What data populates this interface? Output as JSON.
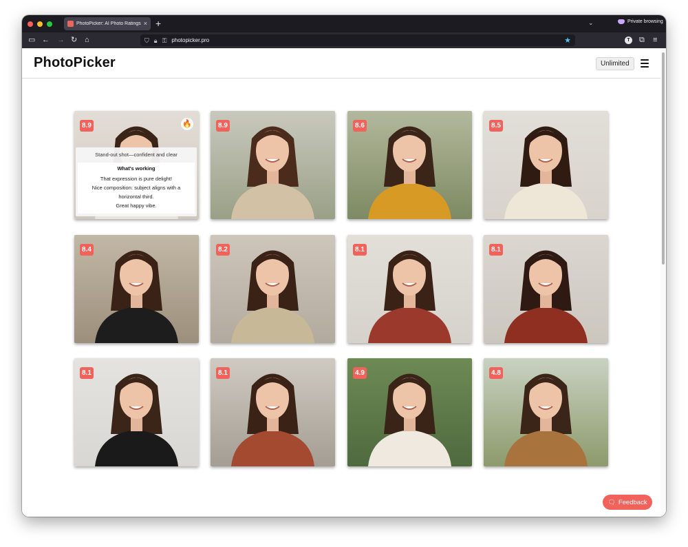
{
  "browser": {
    "tab_title": "PhotoPicker: AI Photo Ratings fo",
    "tab_close": "×",
    "new_tab": "+",
    "private_label": "Private browsing",
    "url": "photopicker.pro",
    "profile_initial": "T"
  },
  "site": {
    "logo": "PhotoPicker",
    "plan_label": "Unlimited"
  },
  "overlay": {
    "headline": "Stand-out shot—confident and clear",
    "working_title": "What's working",
    "points": [
      "That expression is pure delight!",
      "Nice composition: subject aligns with a horizontal third.",
      "Great happy vibe."
    ]
  },
  "photos": [
    {
      "score": "8.9",
      "badge": "fire-icon",
      "bg": "#cfc8bf",
      "top": "#e2ddd6",
      "outfit": "#e9e4dc",
      "hair": "#3a2418"
    },
    {
      "score": "8.9",
      "bg": "#9aa087",
      "top": "#c8c9bd",
      "outfit": "#d2c1a4",
      "hair": "#4b2c1c"
    },
    {
      "score": "8.6",
      "bg": "#7d8a62",
      "top": "#b3b89c",
      "outfit": "#d79a24",
      "hair": "#3b2418"
    },
    {
      "score": "8.5",
      "bg": "#d8d3cc",
      "top": "#e2ded8",
      "outfit": "#eee6d6",
      "hair": "#2f1b12"
    },
    {
      "score": "8.4",
      "bg": "#9c8f7c",
      "top": "#c2b8a6",
      "outfit": "#1d1d1d",
      "hair": "#3a2216"
    },
    {
      "score": "8.2",
      "bg": "#b2aa9d",
      "top": "#cdc6ba",
      "outfit": "#c7b897",
      "hair": "#3b2216"
    },
    {
      "score": "8.1",
      "bg": "#d6d2cb",
      "top": "#e2dfd9",
      "outfit": "#9b3a2c",
      "hair": "#3a2216"
    },
    {
      "score": "8.1",
      "bg": "#cbc6be",
      "top": "#dbd7d0",
      "outfit": "#8e2f22",
      "hair": "#2e1a12"
    },
    {
      "score": "8.1",
      "bg": "#d9d7d3",
      "top": "#e5e3df",
      "outfit": "#1a1a1a",
      "hair": "#3b2418"
    },
    {
      "score": "8.1",
      "bg": "#a49d93",
      "top": "#cfcac2",
      "outfit": "#a34a31",
      "hair": "#3a2216"
    },
    {
      "score": "4.9",
      "bg": "#4f6a3e",
      "top": "#6d8a55",
      "outfit": "#efe9df",
      "hair": "#3a2418"
    },
    {
      "score": "4.8",
      "bg": "#8d9a6b",
      "top": "#c9d2c2",
      "outfit": "#a8733d",
      "hair": "#3b2418"
    }
  ],
  "feedback_label": "Feedback"
}
